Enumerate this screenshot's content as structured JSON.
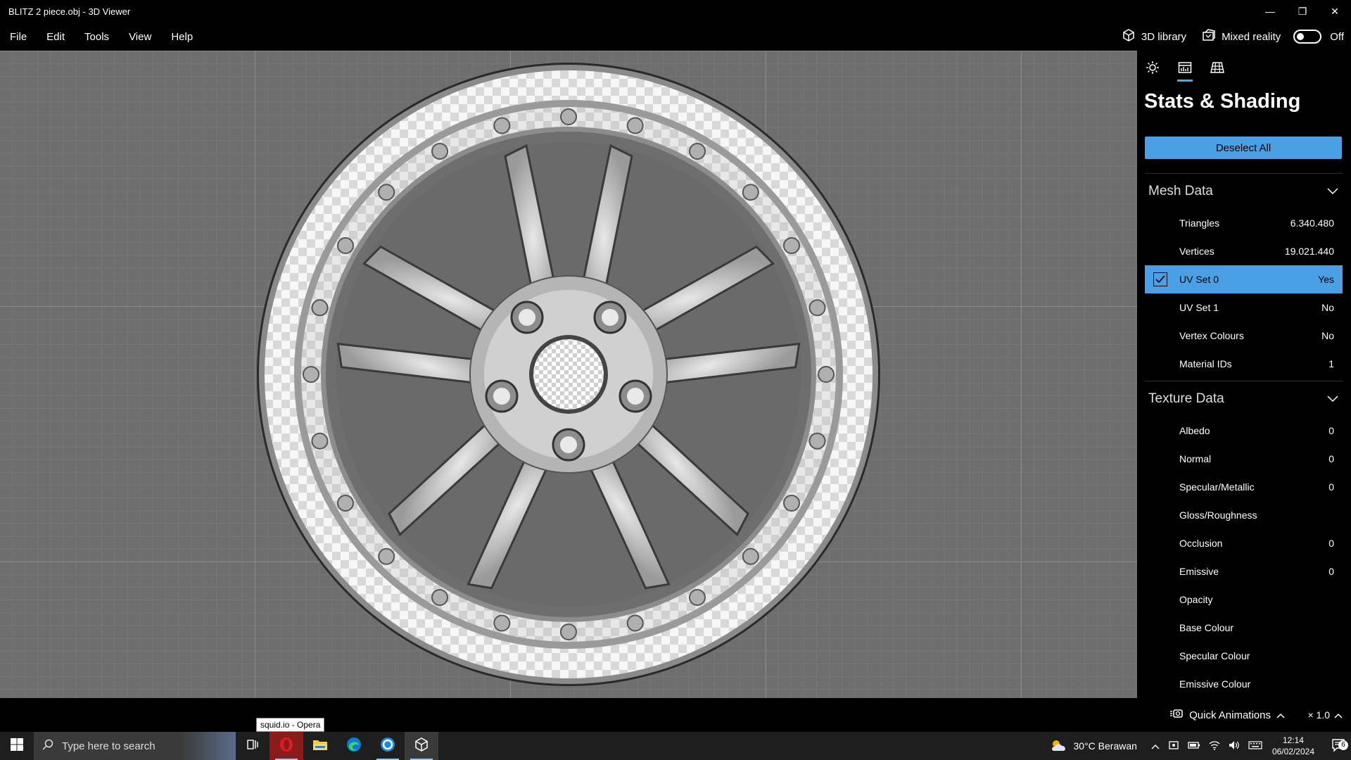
{
  "window": {
    "title": "BLITZ 2 piece.obj - 3D Viewer",
    "minimize": "—",
    "restore": "❐",
    "close": "✕"
  },
  "menu": {
    "items": [
      "File",
      "Edit",
      "Tools",
      "View",
      "Help"
    ]
  },
  "menu_right": {
    "library": "3D library",
    "mixed_reality": "Mixed reality",
    "toggle_state": "Off"
  },
  "panel": {
    "title": "Stats & Shading",
    "deselect": "Deselect All",
    "mesh": {
      "heading": "Mesh Data",
      "rows": [
        {
          "label": "Triangles",
          "value": "6.340.480"
        },
        {
          "label": "Vertices",
          "value": "19.021.440"
        },
        {
          "label": "UV Set 0",
          "value": "Yes"
        },
        {
          "label": "UV Set 1",
          "value": "No"
        },
        {
          "label": "Vertex Colours",
          "value": "No"
        },
        {
          "label": "Material IDs",
          "value": "1"
        }
      ]
    },
    "texture": {
      "heading": "Texture Data",
      "rows": [
        {
          "label": "Albedo",
          "value": "0"
        },
        {
          "label": "Normal",
          "value": "0"
        },
        {
          "label": "Specular/Metallic",
          "value": "0"
        },
        {
          "label": "Gloss/Roughness",
          "value": ""
        },
        {
          "label": "Occlusion",
          "value": "0"
        },
        {
          "label": "Emissive",
          "value": "0"
        },
        {
          "label": "Opacity",
          "value": ""
        },
        {
          "label": "Base Colour",
          "value": ""
        },
        {
          "label": "Specular Colour",
          "value": ""
        },
        {
          "label": "Emissive Colour",
          "value": ""
        }
      ]
    }
  },
  "bottom": {
    "quick_animations": "Quick Animations",
    "speed": "× 1.0",
    "tooltip": "squid.io - Opera"
  },
  "taskbar": {
    "search_placeholder": "Type here to search",
    "weather": "30°C  Berawan",
    "time": "12:14",
    "date": "06/02/2024",
    "notifications": "6"
  },
  "colors": {
    "accent": "#4a9fe5",
    "viewport_bg": "#6e6e6e",
    "opera": "#e01a22"
  }
}
